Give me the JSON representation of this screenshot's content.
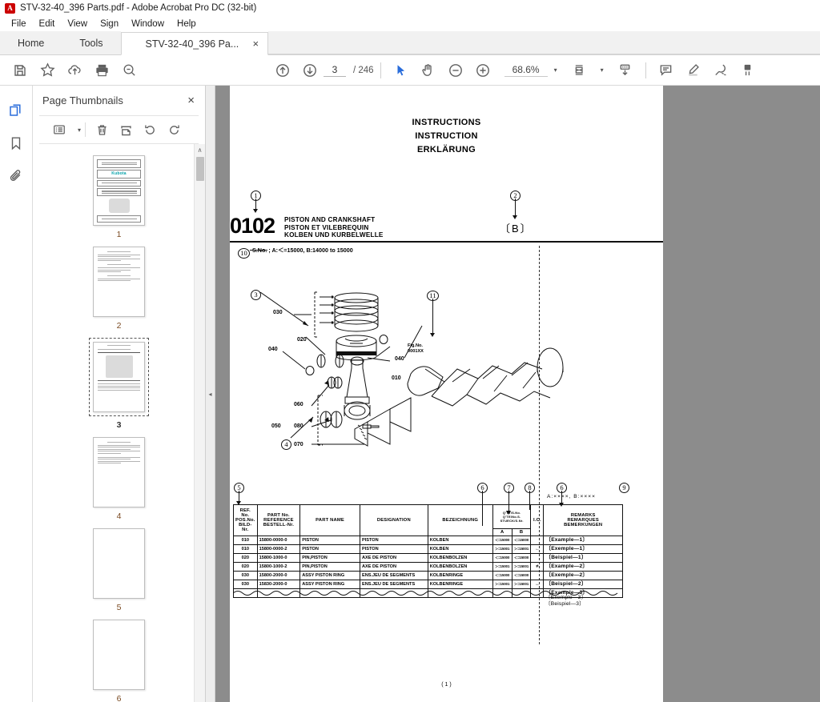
{
  "window": {
    "title": "STV-32-40_396 Parts.pdf - Adobe Acrobat Pro DC (32-bit)",
    "logo_letter": "A"
  },
  "menubar": {
    "items": [
      {
        "label": "File"
      },
      {
        "label": "Edit"
      },
      {
        "label": "View"
      },
      {
        "label": "Sign"
      },
      {
        "label": "Window"
      },
      {
        "label": "Help"
      }
    ]
  },
  "tabs": {
    "home": "Home",
    "tools": "Tools",
    "document": "STV-32-40_396 Pa...",
    "close_glyph": "×"
  },
  "toolbar": {
    "save_icon": "save-icon",
    "star_icon": "star-icon",
    "cloud_upload_icon": "cloud-upload-icon",
    "print_icon": "print-icon",
    "search_icon": "search-icon",
    "prev_page_icon": "arrow-up-circle-icon",
    "next_page_icon": "arrow-down-circle-icon",
    "page_number": "3",
    "page_total": "/ 246",
    "select_tool_icon": "cursor-arrow-icon",
    "hand_tool_icon": "hand-icon",
    "zoom_out_icon": "zoom-out-icon",
    "zoom_in_icon": "zoom-in-icon",
    "zoom_level": "68.6%",
    "fit_page_icon": "fit-page-icon",
    "scroll_mode_icon": "page-scroll-icon",
    "comment_icon": "comment-icon",
    "highlight_icon": "highlighter-icon",
    "draw_icon": "draw-freehand-icon",
    "fill_sign_icon": "fill-and-sign-icon",
    "caret_glyph": "▾"
  },
  "rail": {
    "items": [
      {
        "name": "page-thumbnails-icon",
        "active": true
      },
      {
        "name": "bookmarks-icon",
        "active": false
      },
      {
        "name": "attachments-icon",
        "active": false
      }
    ]
  },
  "thumbnail_panel": {
    "title": "Page Thumbnails",
    "close_glyph": "×",
    "toolbar": {
      "options_icon": "list-options-icon",
      "caret_glyph": "▾",
      "delete_icon": "trash-icon",
      "extract_icon": "extract-pages-icon",
      "rotate_ccw_icon": "rotate-counterclockwise-icon",
      "rotate_cw_icon": "rotate-clockwise-icon"
    },
    "scroll_up_glyph": "∧",
    "pages": [
      {
        "number": "1",
        "selected": false,
        "kind": "cover"
      },
      {
        "number": "2",
        "selected": false,
        "kind": "text"
      },
      {
        "number": "3",
        "selected": true,
        "kind": "diagram"
      },
      {
        "number": "4",
        "selected": false,
        "kind": "text"
      },
      {
        "number": "5",
        "selected": false,
        "kind": "blank"
      },
      {
        "number": "6",
        "selected": false,
        "kind": "blank"
      }
    ],
    "cover": {
      "top_line": "ILLUSTRATED PARTS LIST",
      "brand": "Kubota",
      "sub1": "AIR COOLED",
      "sub2": "TRACTOR",
      "sub3": "TRACTEUR",
      "bottom": "Kubota"
    }
  },
  "collapse_handle": {
    "glyph": "◂"
  },
  "document": {
    "instructions": [
      "INSTRUCTIONS",
      "INSTRUCTION",
      "ERKLÄRUNG"
    ],
    "section_number": "0102",
    "section_titles": [
      "PISTON AND CRANKSHAFT",
      "PISTON ET VILEBREQUIN",
      "KOLBEN UND KURBELWELLE"
    ],
    "section_group": "〔B〕",
    "serial_note": "S.No. ; A:＜=15000, B:14000 to 15000",
    "ab_header": "A:××××, B:××××",
    "footer": "( 1 )",
    "callouts": [
      "1",
      "2",
      "3",
      "4",
      "5",
      "6",
      "7",
      "8",
      "9",
      "10",
      "11"
    ],
    "fig_no": [
      "Fig.No.",
      "0001XX"
    ],
    "diagram_labels": [
      "030",
      "020",
      "040",
      "040",
      "010",
      "060",
      "050",
      "080",
      "070"
    ],
    "table": {
      "headers": [
        "REF. No.\nPOS.No.\nBILD-Nr.",
        "PART No.\nREFERENCE\nBESTELL-Nr.",
        "PART NAME",
        "DESIGNATION",
        "BEZEICHNUNG",
        "Q'TY/S.No.\nQ'TE/No.S.\nSTUECK/S.Nr.",
        "I.C.",
        "REMARKS\nREMARQUES\nBEMERKUNGEN"
      ],
      "qty_subheaders": [
        "A",
        "B"
      ],
      "rows": [
        {
          "ref": "010",
          "part_no": "15800-0000-0",
          "part_name": "PISTON",
          "designation": "PISTON",
          "bezeichnung": "KOLBEN",
          "qty_a": "＜=15000",
          "qty_b": "＜=15000",
          "ic": "",
          "remark": "〔Example—1〕"
        },
        {
          "ref": "010",
          "part_no": "15800-0000-2",
          "part_name": "PISTON",
          "designation": "PISTON",
          "bezeichnung": "KOLBEN",
          "qty_a": "＞=15001",
          "qty_b": "＞=15001",
          "ic": "←",
          "remark": "〔Exemple—1〕"
        },
        {
          "ref": "020",
          "part_no": "15800-1000-0",
          "part_name": "PIN,PISTON",
          "designation": "AXE DE PISTON",
          "bezeichnung": "KOLBENBOLZEN",
          "qty_a": "＜=15000",
          "qty_b": "＜=15000",
          "ic": "",
          "remark": "〔Beispiel—1〕"
        },
        {
          "ref": "020",
          "part_no": "15800-1000-2",
          "part_name": "PIN,PISTON",
          "designation": "AXE DE PISTON",
          "bezeichnung": "KOLBENBOLZEN",
          "qty_a": "＞=15001",
          "qty_b": "＞=15001",
          "ic": "≠",
          "remark": "〔Example—2〕"
        },
        {
          "ref": "030",
          "part_no": "15800-2000-0",
          "part_name": "ASSY PISTON RING",
          "designation": "ENS.JEU DE SEGMENTS",
          "bezeichnung": "KOLBENRINGE",
          "qty_a": "＜=15000",
          "qty_b": "＜=15000",
          "ic": "",
          "remark": "〔Exemple—2〕"
        },
        {
          "ref": "030",
          "part_no": "15830-2000-0",
          "part_name": "ASSY PISTON RING",
          "designation": "ENS.JEU DE SEGMENTS",
          "bezeichnung": "KOLBENRINGE",
          "qty_a": "＞=15001",
          "qty_b": "＞=15001",
          "ic": "↔",
          "remark": "〔Beispiel—2〕"
        }
      ],
      "trailing_remarks": [
        "〔Example—3〕",
        "〔Exemple—3〕",
        "〔Beispiel—3〕"
      ]
    }
  },
  "colors": {
    "accent": "#2a6ddb",
    "viewport_bg": "#8c8c8c",
    "chrome": "#f1f1f1",
    "brand_red": "#cc0000",
    "kubota_teal": "#00a0a8"
  }
}
